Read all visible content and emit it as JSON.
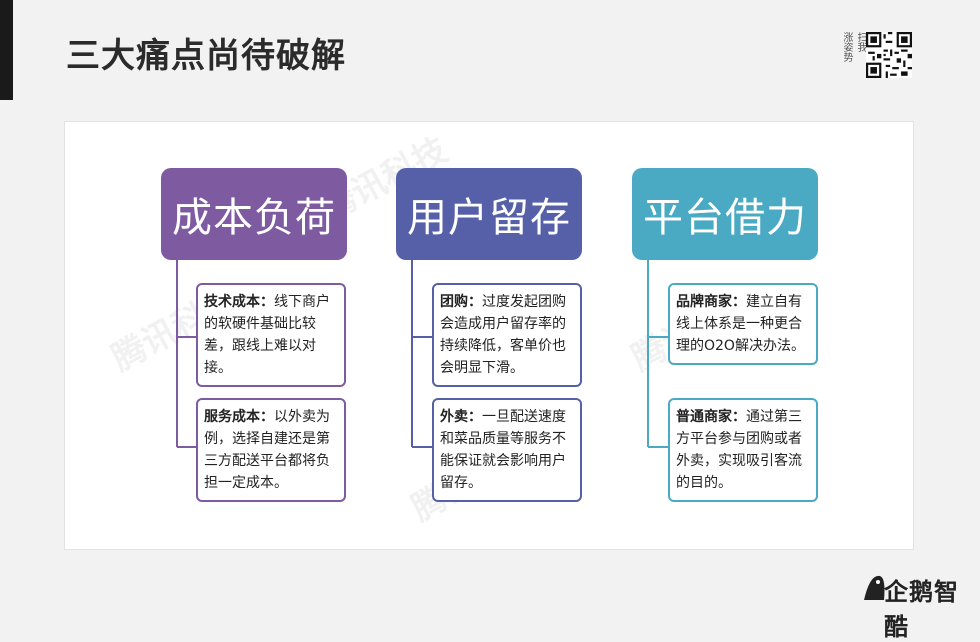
{
  "title": "三大痛点尚待破解",
  "qr": {
    "caption_col1": "扫我",
    "caption_col2": "涨姿势"
  },
  "watermark_text": "腾讯科技",
  "columns": [
    {
      "header": "成本负荷",
      "color": "#7e5aa0",
      "cards": [
        {
          "term": "技术成本：",
          "text": "线下商户的软硬件基础比较差，跟线上难以对接。"
        },
        {
          "term": "服务成本：",
          "text": "以外卖为例，选择自建还是第三方配送平台都将负担一定成本。"
        }
      ]
    },
    {
      "header": "用户留存",
      "color": "#5560a8",
      "cards": [
        {
          "term": "团购：",
          "text": "过度发起团购会造成用户留存率的持续降低，客单价也会明显下滑。"
        },
        {
          "term": "外卖：",
          "text": "一旦配送速度和菜品质量等服务不能保证就会影响用户留存。"
        }
      ]
    },
    {
      "header": "平台借力",
      "color": "#4aaac4",
      "cards": [
        {
          "term": "品牌商家：",
          "text": "建立自有线上体系是一种更合理的O2O解决办法。"
        },
        {
          "term": "普通商家：",
          "text": "通过第三方平台参与团购或者外卖，实现吸引客流的目的。"
        }
      ]
    }
  ],
  "logo_text": "企鹅智酷"
}
